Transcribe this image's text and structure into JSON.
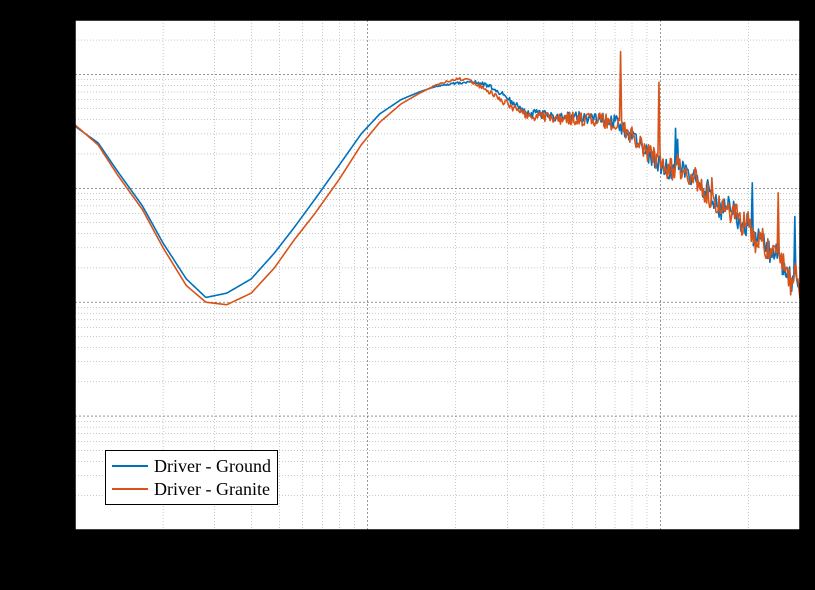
{
  "chart_data": {
    "type": "line",
    "xscale": "log",
    "yscale": "log",
    "xrange": [
      10,
      3000
    ],
    "yrange": [
      0.0001,
      3
    ],
    "xticks_major": [
      10,
      100,
      1000
    ],
    "yticks_major": [
      0.0001,
      0.001,
      0.01,
      0.1,
      1
    ],
    "grid": {
      "major": true,
      "minor": true
    },
    "legend": {
      "position": "lower-left",
      "entries": [
        {
          "label": "Driver - Ground",
          "color": "#0072BD"
        },
        {
          "label": "Driver - Granite",
          "color": "#D95319"
        }
      ]
    },
    "series": [
      {
        "name": "Driver - Ground",
        "color": "#0072BD",
        "x": [
          10,
          12,
          14,
          17,
          20,
          24,
          28,
          33,
          40,
          48,
          56,
          66,
          80,
          95,
          110,
          130,
          150,
          170,
          190,
          205,
          220,
          235,
          250,
          270,
          290,
          310,
          330,
          360,
          400,
          440,
          480,
          520,
          560,
          600,
          650,
          700,
          750,
          800,
          850,
          900,
          950,
          1000,
          1050,
          1100,
          1150,
          1200,
          1250,
          1300,
          1350,
          1400,
          1450,
          1500,
          1600,
          1700,
          1800,
          1900,
          2000,
          2100,
          2200,
          2300,
          2400,
          2500,
          2600,
          2700,
          2800,
          2900,
          3000
        ],
        "y": [
          0.35,
          0.25,
          0.14,
          0.07,
          0.033,
          0.016,
          0.011,
          0.012,
          0.016,
          0.027,
          0.045,
          0.08,
          0.16,
          0.3,
          0.45,
          0.6,
          0.7,
          0.78,
          0.82,
          0.84,
          0.86,
          0.85,
          0.82,
          0.75,
          0.66,
          0.58,
          0.5,
          0.46,
          0.44,
          0.43,
          0.42,
          0.42,
          0.41,
          0.41,
          0.4,
          0.38,
          0.33,
          0.3,
          0.24,
          0.2,
          0.18,
          0.16,
          0.15,
          0.14,
          0.155,
          0.14,
          0.12,
          0.125,
          0.105,
          0.09,
          0.1,
          0.08,
          0.065,
          0.075,
          0.06,
          0.045,
          0.05,
          0.035,
          0.04,
          0.03,
          0.025,
          0.03,
          0.022,
          0.02,
          0.015,
          0.018,
          0.012
        ]
      },
      {
        "name": "Driver - Granite",
        "color": "#D95319",
        "x": [
          10,
          12,
          14,
          17,
          20,
          24,
          28,
          33,
          40,
          48,
          56,
          66,
          80,
          95,
          110,
          130,
          150,
          170,
          190,
          205,
          220,
          235,
          250,
          270,
          290,
          310,
          330,
          360,
          400,
          440,
          480,
          520,
          560,
          600,
          650,
          700,
          750,
          800,
          850,
          900,
          950,
          1000,
          1050,
          1100,
          1150,
          1200,
          1250,
          1300,
          1350,
          1400,
          1450,
          1500,
          1600,
          1700,
          1800,
          1900,
          2000,
          2100,
          2200,
          2300,
          2400,
          2500,
          2600,
          2700,
          2800,
          2900,
          3000
        ],
        "y": [
          0.36,
          0.24,
          0.13,
          0.065,
          0.03,
          0.014,
          0.01,
          0.0095,
          0.012,
          0.02,
          0.035,
          0.06,
          0.12,
          0.24,
          0.38,
          0.55,
          0.68,
          0.8,
          0.88,
          0.92,
          0.88,
          0.82,
          0.75,
          0.66,
          0.58,
          0.52,
          0.47,
          0.44,
          0.42,
          0.41,
          0.415,
          0.405,
          0.4,
          0.4,
          0.39,
          0.37,
          0.34,
          0.29,
          0.25,
          0.21,
          0.185,
          0.17,
          0.15,
          0.145,
          0.16,
          0.135,
          0.125,
          0.13,
          0.1,
          0.095,
          0.095,
          0.078,
          0.064,
          0.07,
          0.058,
          0.048,
          0.052,
          0.033,
          0.042,
          0.028,
          0.027,
          0.032,
          0.02,
          0.022,
          0.014,
          0.017,
          0.013
        ]
      }
    ]
  },
  "legend_labels": {
    "s0": "Driver - Ground",
    "s1": "Driver - Granite"
  }
}
